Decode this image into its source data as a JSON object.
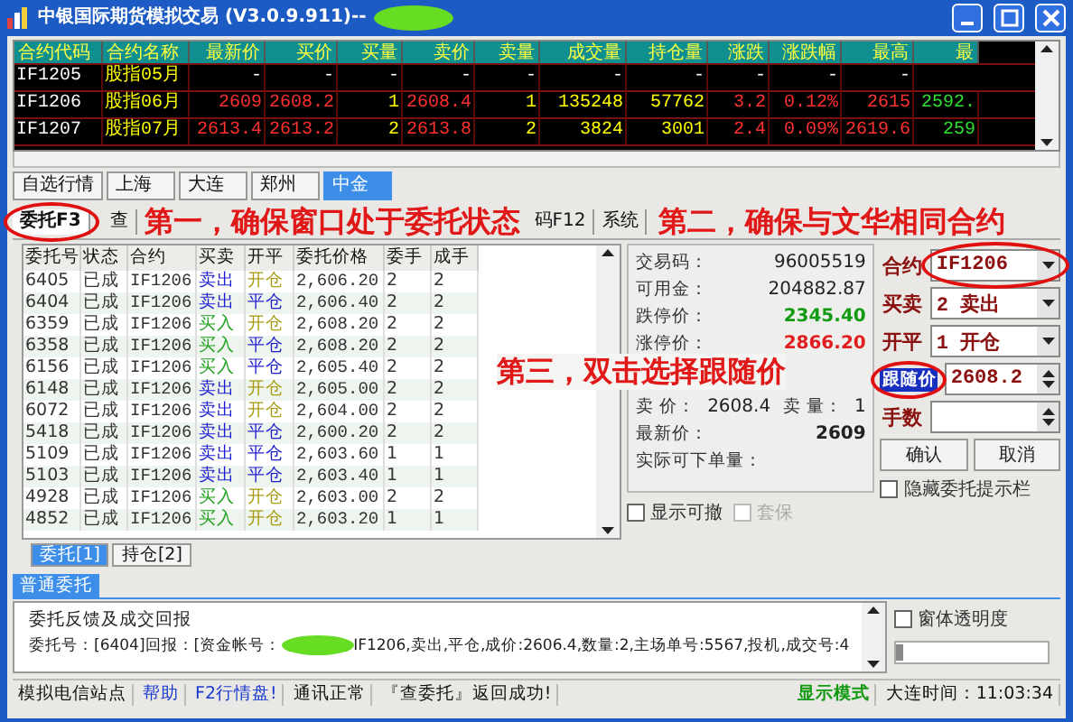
{
  "window": {
    "title": "中银国际期货模拟交易 (V3.0.9.911)--"
  },
  "quotes": {
    "columns": [
      "合约代码",
      "合约名称",
      "最新价",
      "买价",
      "买量",
      "卖价",
      "卖量",
      "成交量",
      "持仓量",
      "涨跌",
      "涨跌幅",
      "最高",
      "最"
    ],
    "rows": [
      {
        "cells": [
          {
            "text": "IF1205",
            "kind": "code"
          },
          {
            "text": "股指05月",
            "kind": "name"
          },
          {
            "text": "-",
            "kind": "flat"
          },
          {
            "text": "-",
            "kind": "flat"
          },
          {
            "text": "-",
            "kind": "flat"
          },
          {
            "text": "-",
            "kind": "flat"
          },
          {
            "text": "-",
            "kind": "flat"
          },
          {
            "text": "-",
            "kind": "flat"
          },
          {
            "text": "-",
            "kind": "flat"
          },
          {
            "text": "-",
            "kind": "flat"
          },
          {
            "text": "-",
            "kind": "flat"
          },
          {
            "text": "-",
            "kind": "flat"
          }
        ]
      },
      {
        "cells": [
          {
            "text": "IF1206",
            "kind": "code"
          },
          {
            "text": "股指06月",
            "kind": "name"
          },
          {
            "text": "2609",
            "kind": "up"
          },
          {
            "text": "2608.2",
            "kind": "up"
          },
          {
            "text": "1",
            "kind": "volume"
          },
          {
            "text": "2608.4",
            "kind": "up"
          },
          {
            "text": "1",
            "kind": "volume"
          },
          {
            "text": "135248",
            "kind": "volume"
          },
          {
            "text": "57762",
            "kind": "volume"
          },
          {
            "text": "3.2",
            "kind": "up"
          },
          {
            "text": "0.12%",
            "kind": "up"
          },
          {
            "text": "2615",
            "kind": "up"
          },
          {
            "text": "2592.",
            "kind": "down"
          }
        ]
      },
      {
        "cells": [
          {
            "text": "IF1207",
            "kind": "code"
          },
          {
            "text": "股指07月",
            "kind": "name"
          },
          {
            "text": "2613.4",
            "kind": "up"
          },
          {
            "text": "2613.2",
            "kind": "up"
          },
          {
            "text": "2",
            "kind": "volume"
          },
          {
            "text": "2613.8",
            "kind": "up"
          },
          {
            "text": "2",
            "kind": "volume"
          },
          {
            "text": "3824",
            "kind": "volume"
          },
          {
            "text": "3001",
            "kind": "volume"
          },
          {
            "text": "2.4",
            "kind": "up"
          },
          {
            "text": "0.09%",
            "kind": "up"
          },
          {
            "text": "2619.6",
            "kind": "up"
          },
          {
            "text": "259",
            "kind": "down"
          }
        ]
      }
    ]
  },
  "market_tabs": [
    {
      "label": "自选行情",
      "selected": false
    },
    {
      "label": "上海",
      "selected": false
    },
    {
      "label": "大连",
      "selected": false
    },
    {
      "label": "郑州",
      "selected": false
    },
    {
      "label": "中金",
      "selected": true
    }
  ],
  "function_tabs": [
    {
      "label": "委托F3",
      "selected": true
    },
    {
      "label": "查",
      "selected": false
    },
    {
      "label": "码F12",
      "selected": false
    },
    {
      "label": "系统",
      "selected": false
    }
  ],
  "orders": {
    "columns": [
      "委托号",
      "状态",
      "合约",
      "买卖",
      "开平",
      "委托价格",
      "委手",
      "成手"
    ],
    "rows": [
      {
        "id": "6405",
        "status": "已成",
        "contract": "IF1206",
        "side": {
          "text": "卖出",
          "kind": "sell"
        },
        "offset": {
          "text": "开仓",
          "kind": "open"
        },
        "price": "2,606.20",
        "qty": "2",
        "filled": "2"
      },
      {
        "id": "6404",
        "status": "已成",
        "contract": "IF1206",
        "side": {
          "text": "卖出",
          "kind": "sell"
        },
        "offset": {
          "text": "平仓",
          "kind": "close"
        },
        "price": "2,606.40",
        "qty": "2",
        "filled": "2"
      },
      {
        "id": "6359",
        "status": "已成",
        "contract": "IF1206",
        "side": {
          "text": "买入",
          "kind": "buy"
        },
        "offset": {
          "text": "开仓",
          "kind": "open"
        },
        "price": "2,608.20",
        "qty": "2",
        "filled": "2"
      },
      {
        "id": "6358",
        "status": "已成",
        "contract": "IF1206",
        "side": {
          "text": "买入",
          "kind": "buy"
        },
        "offset": {
          "text": "平仓",
          "kind": "close"
        },
        "price": "2,608.20",
        "qty": "2",
        "filled": "2"
      },
      {
        "id": "6156",
        "status": "已成",
        "contract": "IF1206",
        "side": {
          "text": "买入",
          "kind": "buy"
        },
        "offset": {
          "text": "平仓",
          "kind": "close"
        },
        "price": "2,605.40",
        "qty": "2",
        "filled": "2"
      },
      {
        "id": "6148",
        "status": "已成",
        "contract": "IF1206",
        "side": {
          "text": "卖出",
          "kind": "sell"
        },
        "offset": {
          "text": "开仓",
          "kind": "open"
        },
        "price": "2,605.00",
        "qty": "2",
        "filled": "2"
      },
      {
        "id": "6072",
        "status": "已成",
        "contract": "IF1206",
        "side": {
          "text": "卖出",
          "kind": "sell"
        },
        "offset": {
          "text": "开仓",
          "kind": "open"
        },
        "price": "2,604.00",
        "qty": "2",
        "filled": "2"
      },
      {
        "id": "5418",
        "status": "已成",
        "contract": "IF1206",
        "side": {
          "text": "卖出",
          "kind": "sell"
        },
        "offset": {
          "text": "平仓",
          "kind": "close"
        },
        "price": "2,600.20",
        "qty": "2",
        "filled": "2"
      },
      {
        "id": "5109",
        "status": "已成",
        "contract": "IF1206",
        "side": {
          "text": "卖出",
          "kind": "sell"
        },
        "offset": {
          "text": "平仓",
          "kind": "close"
        },
        "price": "2,603.60",
        "qty": "1",
        "filled": "1"
      },
      {
        "id": "5103",
        "status": "已成",
        "contract": "IF1206",
        "side": {
          "text": "卖出",
          "kind": "sell"
        },
        "offset": {
          "text": "平仓",
          "kind": "close"
        },
        "price": "2,603.40",
        "qty": "1",
        "filled": "1"
      },
      {
        "id": "4928",
        "status": "已成",
        "contract": "IF1206",
        "side": {
          "text": "买入",
          "kind": "buy"
        },
        "offset": {
          "text": "开仓",
          "kind": "open"
        },
        "price": "2,603.00",
        "qty": "2",
        "filled": "2"
      },
      {
        "id": "4852",
        "status": "已成",
        "contract": "IF1206",
        "side": {
          "text": "买入",
          "kind": "buy"
        },
        "offset": {
          "text": "开仓",
          "kind": "open"
        },
        "price": "2,603.20",
        "qty": "1",
        "filled": "1"
      }
    ]
  },
  "account": [
    {
      "kind": "pair",
      "label": "交易码：",
      "value": "96005519"
    },
    {
      "kind": "pair",
      "label": "可用金：",
      "value": "204882.87"
    },
    {
      "kind": "limit_down",
      "label": "跌停价：",
      "value": "2345.40"
    },
    {
      "kind": "limit_up",
      "label": "涨停价：",
      "value": "2866.20"
    },
    {
      "kind": "quote",
      "label": "卖 价：",
      "value": "2608.4",
      "qty_label": "卖 量：",
      "qty": "1"
    },
    {
      "kind": "pair",
      "label": "最新价：",
      "value": "2609"
    },
    {
      "kind": "pair",
      "label": "实际可下单量："
    }
  ],
  "account_options": [
    {
      "label": "显示可撤",
      "checked": false,
      "disabled": false
    },
    {
      "label": "套保",
      "checked": false,
      "disabled": true
    }
  ],
  "order_form": {
    "fields": [
      {
        "kind": "select",
        "label": "合约",
        "value": "IF1206"
      },
      {
        "kind": "select",
        "label": "买卖",
        "value": "2 卖出"
      },
      {
        "kind": "select",
        "label": "开平",
        "value": "1 开仓"
      },
      {
        "kind": "spin",
        "label": "跟随价",
        "highlighted": true,
        "value": "2608.2"
      },
      {
        "kind": "spin",
        "label": "手数",
        "highlighted": false
      }
    ],
    "buttons": [
      "确认",
      "取消"
    ],
    "hide_tips": {
      "label": "隐藏委托提示栏",
      "checked": false
    }
  },
  "bottom_tabs": [
    {
      "label": "委托[1]",
      "selected": true
    },
    {
      "label": "持仓[2]",
      "selected": false
    }
  ],
  "order_type_tabs": [
    {
      "label": "普通委托",
      "selected": true
    }
  ],
  "feedback": {
    "title": "委托反馈及成交回报",
    "prefix": "委托号：[6404]回报：[资金帐号：",
    "suffix": "IF1206,卖出,平仓,成价:2606.4,数量:2,主场单号:5567,投机,成交号:4"
  },
  "transparency": {
    "label": "窗体透明度",
    "checked": false,
    "level": 0
  },
  "status_bar": [
    {
      "kind": "text",
      "text": "模拟电信站点"
    },
    {
      "kind": "link",
      "text": "帮助"
    },
    {
      "kind": "link",
      "text": "F2行情盘!"
    },
    {
      "kind": "text",
      "text": "通讯正常"
    },
    {
      "kind": "text",
      "text": "『查委托』返回成功!"
    },
    {
      "kind": "mode",
      "text": "显示模式"
    },
    {
      "kind": "text",
      "text": "大连时间：11:03:34"
    }
  ],
  "annotations": [
    {
      "text": "第一，确保窗口处于委托状态"
    },
    {
      "text": "第二，确保与文华相同合约"
    },
    {
      "text": "第三，双击选择跟随价"
    }
  ]
}
